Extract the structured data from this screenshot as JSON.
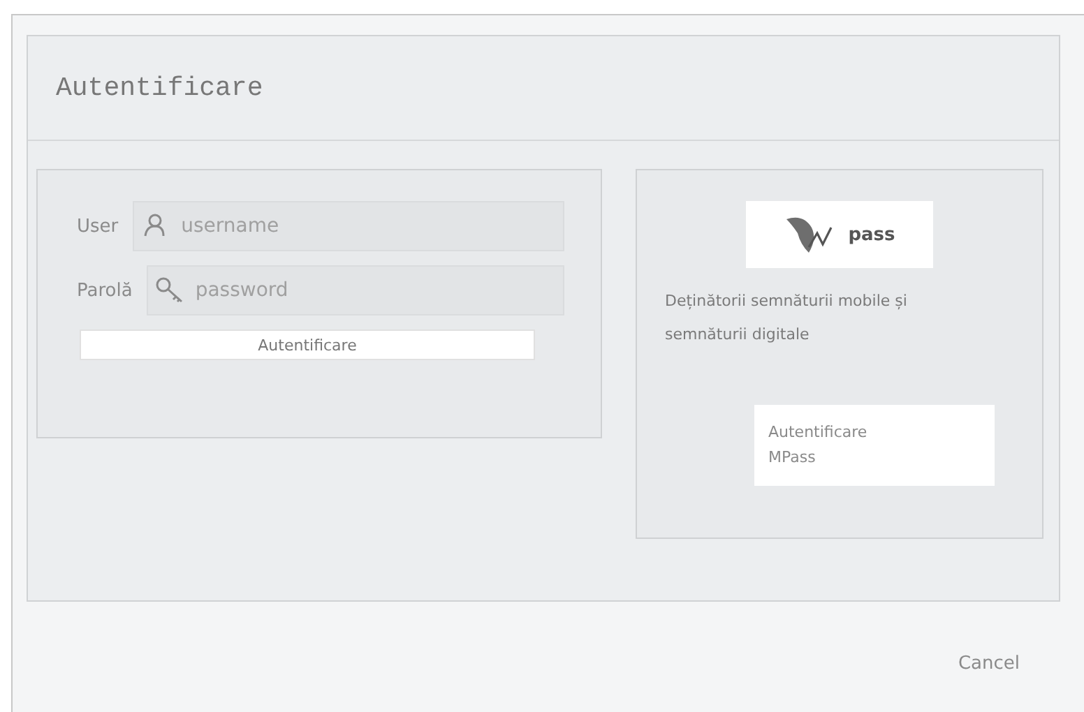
{
  "dialog": {
    "title": "Autentificare"
  },
  "login_form": {
    "user_label": "User",
    "user_placeholder": "username",
    "password_label": "Parolă",
    "password_placeholder": "password",
    "submit": "Autentificare"
  },
  "mpass_panel": {
    "logo_text": "pass",
    "description": "Deținătorii semnăturii mobile și semnăturii digitale",
    "button_lines": [
      "Autentificare",
      "MPass"
    ]
  },
  "footer": {
    "cancel": "Cancel"
  }
}
